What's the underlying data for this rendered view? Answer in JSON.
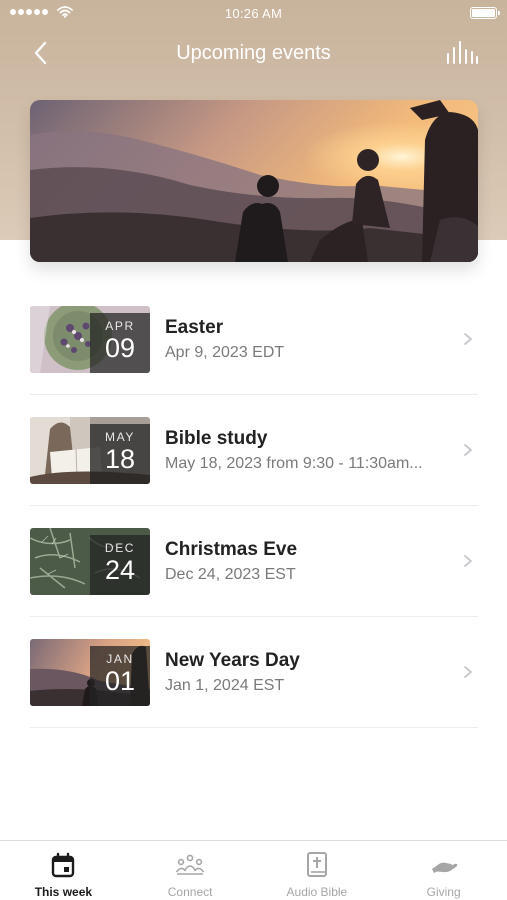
{
  "status_bar": {
    "time": "10:26 AM"
  },
  "header": {
    "title": "Upcoming events"
  },
  "icons": {
    "back": "chevron-left-icon",
    "audio": "audio-bars-icon",
    "row_chevron": "chevron-right-icon"
  },
  "colors": {
    "header_background": "#d2bfaa",
    "active_tab": "#1b1b1b",
    "inactive_tab": "#a6a6a6",
    "subtitle": "#7a7a7a"
  },
  "events": [
    {
      "title": "Easter",
      "subtitle": "Apr 9, 2023 EDT",
      "month": "APR",
      "day": "09"
    },
    {
      "title": "Bible study",
      "subtitle": "May 18, 2023 from 9:30 - 11:30am...",
      "month": "MAY",
      "day": "18"
    },
    {
      "title": "Christmas Eve",
      "subtitle": "Dec 24, 2023 EST",
      "month": "DEC",
      "day": "24"
    },
    {
      "title": "New Years Day",
      "subtitle": "Jan 1, 2024 EST",
      "month": "JAN",
      "day": "01"
    }
  ],
  "tabbar": {
    "active": "This week",
    "tabs": [
      {
        "label": "This week",
        "icon": "calendar-icon"
      },
      {
        "label": "Connect",
        "icon": "people-icon"
      },
      {
        "label": "Audio Bible",
        "icon": "bible-icon"
      },
      {
        "label": "Giving",
        "icon": "giving-hand-icon"
      }
    ]
  }
}
